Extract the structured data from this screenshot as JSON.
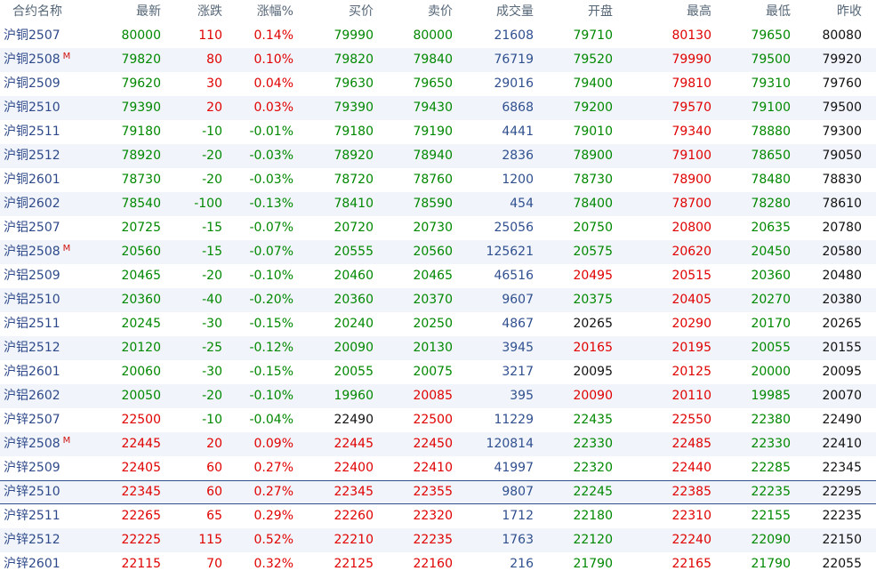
{
  "columns": [
    "合约名称",
    "最新",
    "涨跌",
    "涨幅%",
    "买价",
    "卖价",
    "成交量",
    "开盘",
    "最高",
    "最低",
    "昨收"
  ],
  "colors": {
    "up": "#e00000",
    "down": "#008800",
    "flat": "#111111",
    "volume": "#2f4f8f",
    "name": "#2f4a8a"
  },
  "rows": [
    {
      "name": "沪铜2507",
      "main": "",
      "last": "80000",
      "change": "110",
      "pct": "0.14%",
      "bid": "79990",
      "ask": "80000",
      "volume": "21608",
      "open": "79710",
      "high": "80130",
      "low": "79650",
      "prev": "80080"
    },
    {
      "name": "沪铜2508",
      "main": "M",
      "last": "79820",
      "change": "80",
      "pct": "0.10%",
      "bid": "79820",
      "ask": "79840",
      "volume": "76719",
      "open": "79520",
      "high": "79990",
      "low": "79500",
      "prev": "79920"
    },
    {
      "name": "沪铜2509",
      "main": "",
      "last": "79620",
      "change": "30",
      "pct": "0.04%",
      "bid": "79630",
      "ask": "79650",
      "volume": "29016",
      "open": "79400",
      "high": "79810",
      "low": "79310",
      "prev": "79760"
    },
    {
      "name": "沪铜2510",
      "main": "",
      "last": "79390",
      "change": "20",
      "pct": "0.03%",
      "bid": "79390",
      "ask": "79430",
      "volume": "6868",
      "open": "79200",
      "high": "79570",
      "low": "79100",
      "prev": "79500"
    },
    {
      "name": "沪铜2511",
      "main": "",
      "last": "79180",
      "change": "-10",
      "pct": "-0.01%",
      "bid": "79180",
      "ask": "79190",
      "volume": "4441",
      "open": "79010",
      "high": "79340",
      "low": "78880",
      "prev": "79300"
    },
    {
      "name": "沪铜2512",
      "main": "",
      "last": "78920",
      "change": "-20",
      "pct": "-0.03%",
      "bid": "78920",
      "ask": "78940",
      "volume": "2836",
      "open": "78900",
      "high": "79100",
      "low": "78650",
      "prev": "79050"
    },
    {
      "name": "沪铜2601",
      "main": "",
      "last": "78730",
      "change": "-20",
      "pct": "-0.03%",
      "bid": "78720",
      "ask": "78760",
      "volume": "1200",
      "open": "78730",
      "high": "78900",
      "low": "78480",
      "prev": "78830"
    },
    {
      "name": "沪铜2602",
      "main": "",
      "last": "78540",
      "change": "-100",
      "pct": "-0.13%",
      "bid": "78410",
      "ask": "78590",
      "volume": "454",
      "open": "78400",
      "high": "78700",
      "low": "78280",
      "prev": "78610"
    },
    {
      "name": "沪铝2507",
      "main": "",
      "last": "20725",
      "change": "-15",
      "pct": "-0.07%",
      "bid": "20720",
      "ask": "20730",
      "volume": "25056",
      "open": "20750",
      "high": "20800",
      "low": "20635",
      "prev": "20780"
    },
    {
      "name": "沪铝2508",
      "main": "M",
      "last": "20560",
      "change": "-15",
      "pct": "-0.07%",
      "bid": "20555",
      "ask": "20560",
      "volume": "125621",
      "open": "20575",
      "high": "20620",
      "low": "20450",
      "prev": "20580"
    },
    {
      "name": "沪铝2509",
      "main": "",
      "last": "20465",
      "change": "-20",
      "pct": "-0.10%",
      "bid": "20460",
      "ask": "20465",
      "volume": "46516",
      "open": "20495",
      "high": "20515",
      "low": "20360",
      "prev": "20480"
    },
    {
      "name": "沪铝2510",
      "main": "",
      "last": "20360",
      "change": "-40",
      "pct": "-0.20%",
      "bid": "20360",
      "ask": "20370",
      "volume": "9607",
      "open": "20375",
      "high": "20405",
      "low": "20270",
      "prev": "20380"
    },
    {
      "name": "沪铝2511",
      "main": "",
      "last": "20245",
      "change": "-30",
      "pct": "-0.15%",
      "bid": "20240",
      "ask": "20250",
      "volume": "4867",
      "open": "20265",
      "high": "20290",
      "low": "20170",
      "prev": "20265"
    },
    {
      "name": "沪铝2512",
      "main": "",
      "last": "20120",
      "change": "-25",
      "pct": "-0.12%",
      "bid": "20090",
      "ask": "20130",
      "volume": "3945",
      "open": "20165",
      "high": "20195",
      "low": "20055",
      "prev": "20155"
    },
    {
      "name": "沪铝2601",
      "main": "",
      "last": "20060",
      "change": "-30",
      "pct": "-0.15%",
      "bid": "20055",
      "ask": "20075",
      "volume": "3217",
      "open": "20095",
      "high": "20125",
      "low": "20000",
      "prev": "20095"
    },
    {
      "name": "沪铝2602",
      "main": "",
      "last": "20050",
      "change": "-20",
      "pct": "-0.10%",
      "bid": "19960",
      "ask": "20085",
      "volume": "395",
      "open": "20090",
      "high": "20110",
      "low": "19985",
      "prev": "20070"
    },
    {
      "name": "沪锌2507",
      "main": "",
      "last": "22500",
      "change": "-10",
      "pct": "-0.04%",
      "bid": "22490",
      "ask": "22500",
      "volume": "11229",
      "open": "22435",
      "high": "22550",
      "low": "22380",
      "prev": "22490"
    },
    {
      "name": "沪锌2508",
      "main": "M",
      "last": "22445",
      "change": "20",
      "pct": "0.09%",
      "bid": "22445",
      "ask": "22450",
      "volume": "120814",
      "open": "22330",
      "high": "22485",
      "low": "22330",
      "prev": "22410"
    },
    {
      "name": "沪锌2509",
      "main": "",
      "last": "22405",
      "change": "60",
      "pct": "0.27%",
      "bid": "22400",
      "ask": "22410",
      "volume": "41997",
      "open": "22320",
      "high": "22440",
      "low": "22285",
      "prev": "22345"
    },
    {
      "name": "沪锌2510",
      "main": "",
      "last": "22345",
      "change": "60",
      "pct": "0.27%",
      "bid": "22345",
      "ask": "22355",
      "volume": "9807",
      "open": "22245",
      "high": "22385",
      "low": "22235",
      "prev": "22295"
    },
    {
      "name": "沪锌2511",
      "main": "",
      "last": "22265",
      "change": "65",
      "pct": "0.29%",
      "bid": "22260",
      "ask": "22320",
      "volume": "1712",
      "open": "22180",
      "high": "22310",
      "low": "22155",
      "prev": "22235"
    },
    {
      "name": "沪锌2512",
      "main": "",
      "last": "22225",
      "change": "115",
      "pct": "0.52%",
      "bid": "22210",
      "ask": "22235",
      "volume": "1763",
      "open": "22120",
      "high": "22240",
      "low": "22090",
      "prev": "22150"
    },
    {
      "name": "沪锌2601",
      "main": "",
      "last": "22115",
      "change": "70",
      "pct": "0.32%",
      "bid": "22125",
      "ask": "22160",
      "volume": "216",
      "open": "21790",
      "high": "22165",
      "low": "21790",
      "prev": "22055"
    }
  ]
}
